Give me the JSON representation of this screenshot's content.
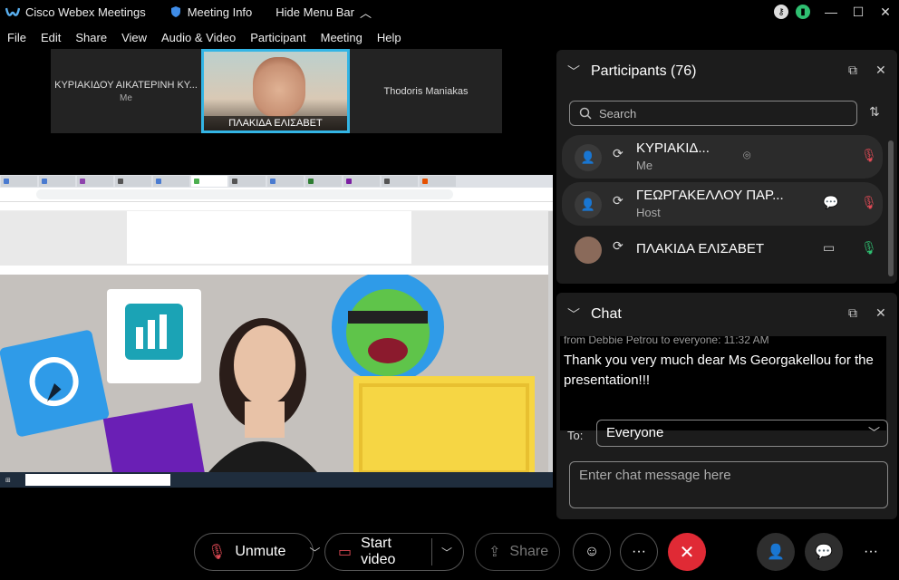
{
  "titlebar": {
    "app_name": "Cisco Webex Meetings",
    "meeting_info": "Meeting Info",
    "hide_menu": "Hide Menu Bar"
  },
  "menu": [
    "File",
    "Edit",
    "Share",
    "View",
    "Audio & Video",
    "Participant",
    "Meeting",
    "Help"
  ],
  "strip": {
    "left_name": "ΚΥΡΙΑΚΙΔΟΥ ΑΙΚΑΤΕΡΙΝΗ ΚΥ...",
    "left_sub": "Me",
    "center_name": "ΠΛΑΚΙΔΑ ΕΛΙΣΑΒΕΤ",
    "right_name": "Thodoris Maniakas"
  },
  "participants": {
    "title": "Participants (76)",
    "search_placeholder": "Search",
    "rows": [
      {
        "name": "ΚΥΡΙΑΚΙΔ...",
        "role": "Me"
      },
      {
        "name": "ΓΕΩΡΓΑΚΕΛΛΟΥ ΠΑΡ...",
        "role": "Host"
      },
      {
        "name": "ΠΛΑΚΙΔΑ ΕΛΙΣΑΒΕΤ",
        "role": ""
      }
    ]
  },
  "chat": {
    "title": "Chat",
    "from_line": "from Debbie Petrou to everyone:     11:32 AM",
    "message": "Thank you very much dear Ms Georgakellou for the presentation!!!",
    "to_label": "To:",
    "to_value": "Everyone",
    "input_placeholder": "Enter chat message here"
  },
  "controls": {
    "unmute": "Unmute",
    "start_video": "Start video",
    "share": "Share"
  },
  "colors": {
    "accent_tile": "#33b5e5",
    "end_red": "#e02a35",
    "mute_red": "#e04a55",
    "mic_green": "#2fbf71"
  }
}
